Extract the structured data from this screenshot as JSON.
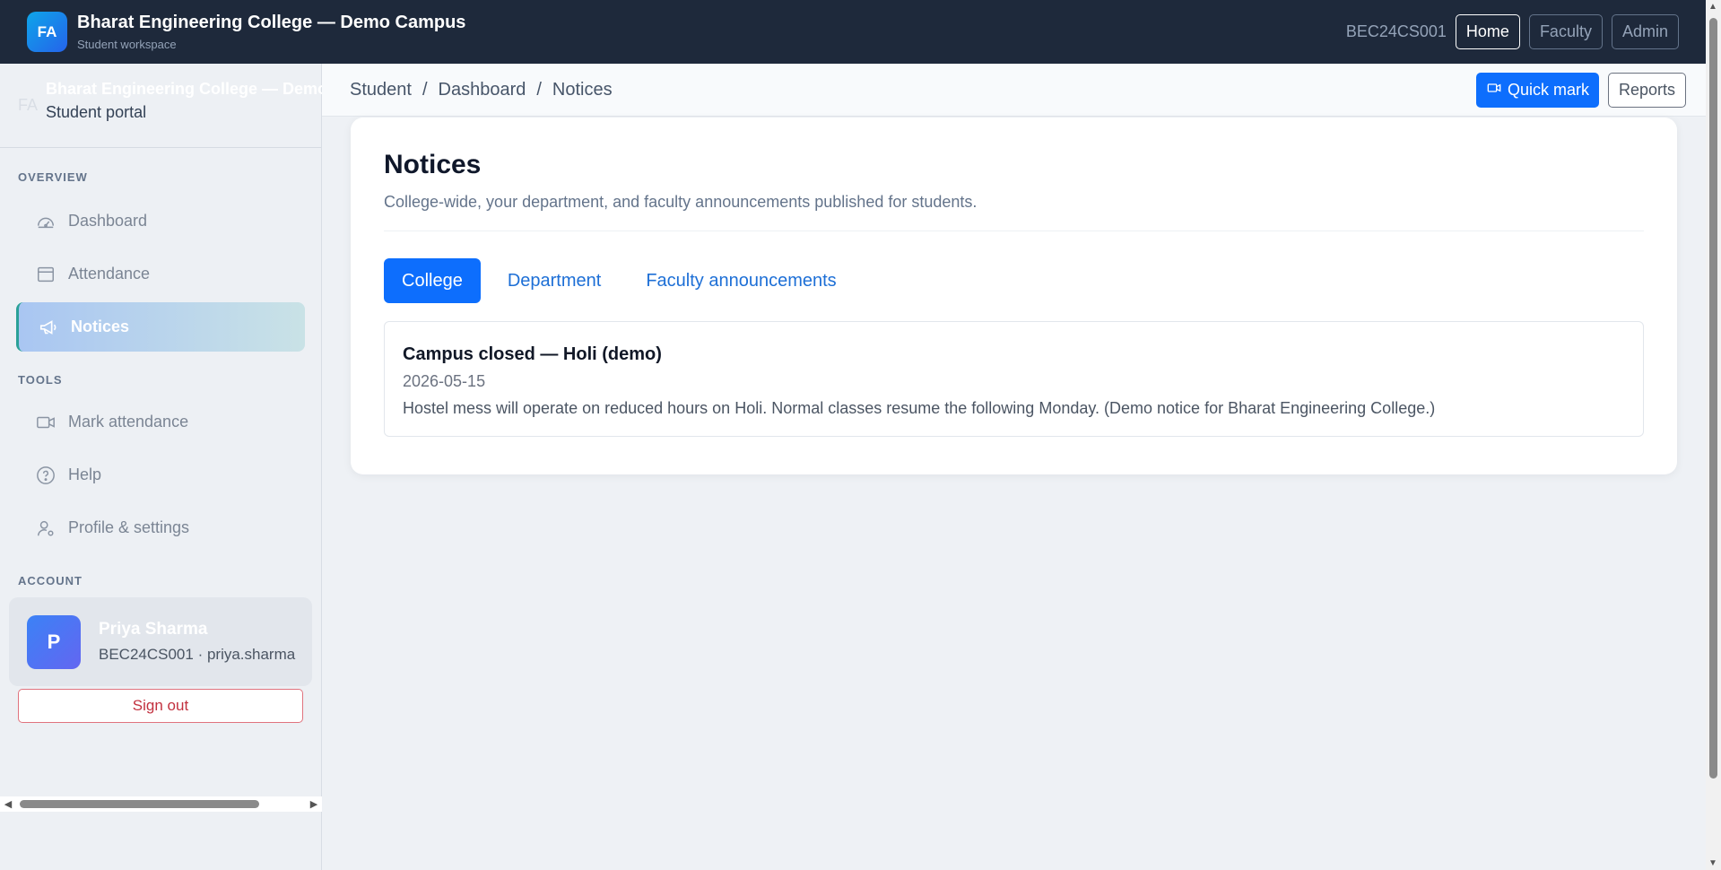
{
  "topbar": {
    "logo": "FA",
    "title": "Bharat Engineering College — Demo Campus",
    "subtitle": "Student workspace",
    "user_code": "BEC24CS001",
    "nav": [
      {
        "label": "Home"
      },
      {
        "label": "Faculty"
      },
      {
        "label": "Admin"
      }
    ]
  },
  "sidebar": {
    "mini_logo": "FA",
    "college": "Bharat Engineering College — Demo Campus",
    "portal": "Student portal",
    "sections": {
      "overview": "OVERVIEW",
      "tools": "TOOLS",
      "account": "ACCOUNT"
    },
    "items": [
      {
        "label": "Dashboard",
        "icon": "dashboard-icon"
      },
      {
        "label": "Attendance",
        "icon": "calendar-icon"
      },
      {
        "label": "Notices",
        "icon": "megaphone-icon"
      },
      {
        "label": "Mark attendance",
        "icon": "video-icon"
      },
      {
        "label": "Help",
        "icon": "question-icon"
      },
      {
        "label": "Profile & settings",
        "icon": "user-gear-icon"
      }
    ],
    "account": {
      "avatar": "P",
      "name": "Priya Sharma",
      "details": "BEC24CS001 · priya.sharma"
    },
    "signout": "Sign out"
  },
  "breadcrumb": {
    "items": [
      "Student",
      "Dashboard",
      "Notices"
    ],
    "separator": "/"
  },
  "actions": {
    "quick_mark": "Quick mark",
    "reports": "Reports"
  },
  "page": {
    "title": "Notices",
    "description": "College-wide, your department, and faculty announcements published for students.",
    "tabs": [
      {
        "label": "College",
        "active": true
      },
      {
        "label": "Department",
        "active": false
      },
      {
        "label": "Faculty announcements",
        "active": false
      }
    ],
    "notices": [
      {
        "title": "Campus closed — Holi (demo)",
        "date": "2026-05-15",
        "body": "Hostel mess will operate on reduced hours on Holi. Normal classes resume the following Monday. (Demo notice for Bharat Engineering College.)"
      }
    ]
  },
  "colors": {
    "navbar": "#1e293b",
    "primary": "#0d6efd",
    "active_accent": "#2aa198",
    "danger": "#c2313f"
  }
}
